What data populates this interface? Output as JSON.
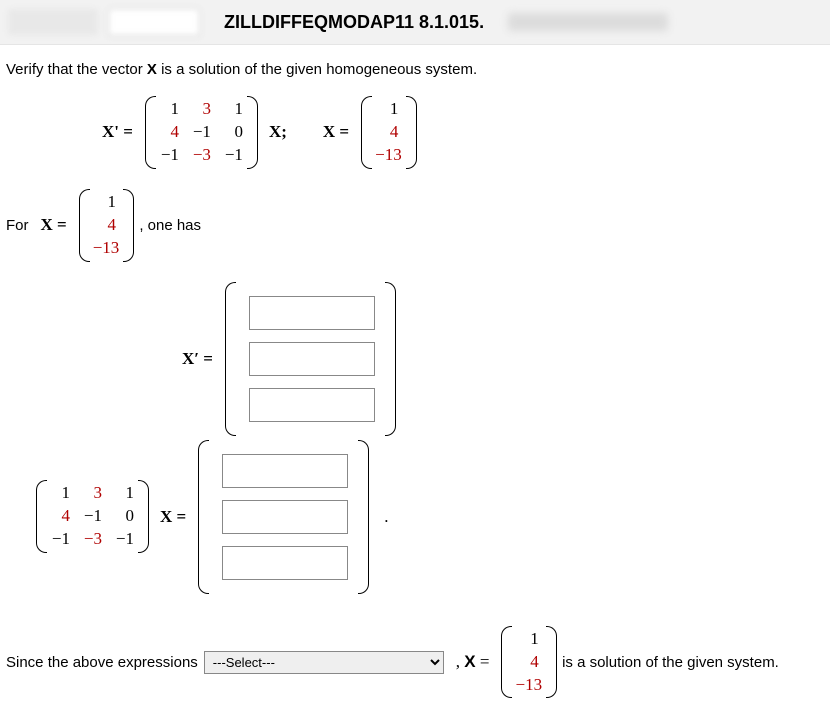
{
  "header": {
    "source_id": "ZILLDIFFEQMODAP11 8.1.015."
  },
  "prompt": "Verify that the vector X is a solution of the given homogeneous system.",
  "matrixA": {
    "label_left": "X' =",
    "rows": [
      [
        "1",
        "3",
        "1"
      ],
      [
        "4",
        "−1",
        "0"
      ],
      [
        "−1",
        "−3",
        "−1"
      ]
    ],
    "red_mask": [
      [
        0,
        1,
        0
      ],
      [
        1,
        0,
        0
      ],
      [
        0,
        1,
        0
      ]
    ],
    "after": "X;"
  },
  "vecX_def": {
    "label": "X =",
    "vals": [
      "1",
      "4",
      "−13"
    ],
    "red": [
      0,
      1,
      1
    ]
  },
  "line2": {
    "pre": "For ",
    "post": ", one has"
  },
  "xprime_block": {
    "label": "X′ ="
  },
  "ax_block": {
    "after_matrix": "X =",
    "period": "."
  },
  "conclusion": {
    "pre": "Since the above expressions ",
    "select_placeholder": "---Select---",
    "mid": ", X =",
    "post": " is a solution of the given system."
  }
}
